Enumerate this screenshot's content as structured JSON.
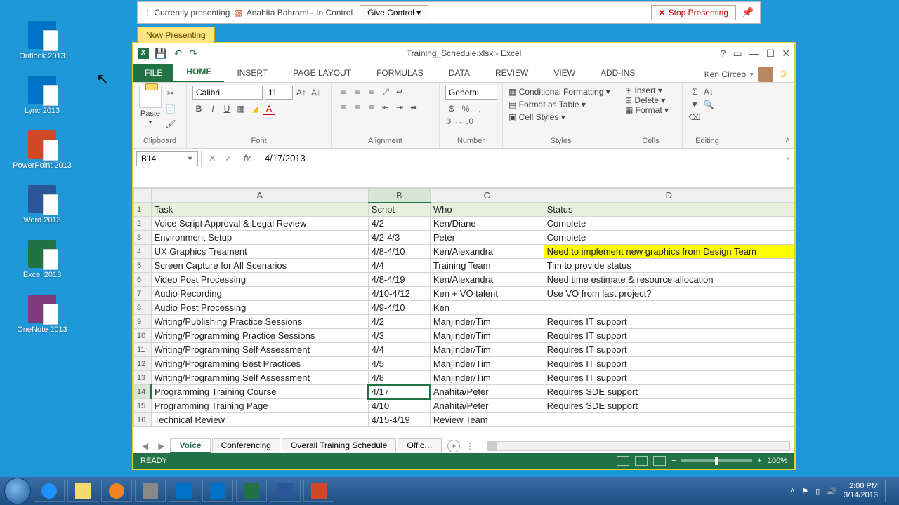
{
  "desktop_icons": [
    {
      "label": "Outlook 2013",
      "cls": "outlook-i"
    },
    {
      "label": "Lync 2013",
      "cls": "lync-i"
    },
    {
      "label": "PowerPoint 2013",
      "cls": "ppt-i"
    },
    {
      "label": "Word 2013",
      "cls": "word-i"
    },
    {
      "label": "Excel 2013",
      "cls": "excel-i"
    },
    {
      "label": "OneNote 2013",
      "cls": "onenote-i"
    }
  ],
  "present_bar": {
    "currently": "Currently presenting",
    "presenter": "Anahita Bahrami - In Control",
    "give_control": "Give Control ▾",
    "stop": "Stop Presenting",
    "now_presenting": "Now Presenting"
  },
  "excel": {
    "title": "Training_Schedule.xlsx - Excel",
    "user": "Ken Circeo",
    "ribbon_tabs": [
      "HOME",
      "INSERT",
      "PAGE LAYOUT",
      "FORMULAS",
      "DATA",
      "REVIEW",
      "VIEW",
      "ADD-INS"
    ],
    "file_tab": "FILE",
    "groups": {
      "clipboard": "Clipboard",
      "paste": "Paste",
      "font": "Font",
      "font_name": "Calibri",
      "font_size": "11",
      "alignment": "Alignment",
      "number": "Number",
      "number_format": "General",
      "styles": "Styles",
      "cond_fmt": "Conditional Formatting",
      "as_table": "Format as Table",
      "cell_styles": "Cell Styles",
      "cells": "Cells",
      "insert": "Insert",
      "delete": "Delete",
      "format": "Format",
      "editing": "Editing"
    },
    "namebox": "B14",
    "formula": "4/17/2013",
    "columns": [
      "A",
      "B",
      "C",
      "D"
    ],
    "header_row": [
      "Task",
      "Script",
      "Who",
      "Status"
    ],
    "rows": [
      {
        "n": 2,
        "cells": [
          "Voice Script Approval & Legal Review",
          "4/2",
          "Ken/Diane",
          "Complete"
        ]
      },
      {
        "n": 3,
        "cells": [
          "Environment Setup",
          "4/2-4/3",
          "Peter",
          "Complete"
        ]
      },
      {
        "n": 4,
        "cells": [
          "UX Graphics Treament",
          "4/8-4/10",
          "Ken/Alexandra",
          "Need to implement new graphics from Design Team"
        ],
        "hl": 3
      },
      {
        "n": 5,
        "cells": [
          "Screen Capture for All Scenarios",
          "4/4",
          "Training Team",
          "Tim to provide status"
        ]
      },
      {
        "n": 6,
        "cells": [
          "Video Post Processing",
          "4/8-4/19",
          "Ken/Alexandra",
          "Need time estimate & resource allocation"
        ]
      },
      {
        "n": 7,
        "cells": [
          "Audio Recording",
          "4/10-4/12",
          "Ken + VO talent",
          "Use VO from last project?"
        ]
      },
      {
        "n": 8,
        "cells": [
          "Audio Post Processing",
          "4/9-4/10",
          "Ken",
          ""
        ]
      },
      {
        "n": 9,
        "cells": [
          "Writing/Publishing Practice Sessions",
          "4/2",
          "Manjinder/Tim",
          "Requires IT support"
        ]
      },
      {
        "n": 10,
        "cells": [
          "Writing/Programming Practice Sessions",
          "4/3",
          "Manjinder/Tim",
          "Requires IT support"
        ]
      },
      {
        "n": 11,
        "cells": [
          "Writing/Programming Self Assessment",
          "4/4",
          "Manjinder/Tim",
          "Requires IT support"
        ]
      },
      {
        "n": 12,
        "cells": [
          "Writing/Programming Best Practices",
          "4/5",
          "Manjinder/Tim",
          "Requires IT support"
        ]
      },
      {
        "n": 13,
        "cells": [
          "Writing/Programming Self Assessment",
          "4/8",
          "Manjinder/Tim",
          "Requires IT support"
        ]
      },
      {
        "n": 14,
        "cells": [
          "Programming Training Course",
          "4/17",
          "Anahita/Peter",
          "Requires SDE support"
        ],
        "selected": true
      },
      {
        "n": 15,
        "cells": [
          "Programming Training Page",
          "4/10",
          "Anahita/Peter",
          "Requires SDE support"
        ]
      },
      {
        "n": 16,
        "cells": [
          "Technical Review",
          "4/15-4/19",
          "Review Team",
          ""
        ]
      }
    ],
    "sheet_tabs": [
      "Voice",
      "Conferencing",
      "Overall Training Schedule",
      "Offic…"
    ],
    "active_sheet": 0,
    "status": "READY",
    "zoom": "100%"
  },
  "taskbar": {
    "time": "2:00 PM",
    "date": "3/14/2013"
  }
}
